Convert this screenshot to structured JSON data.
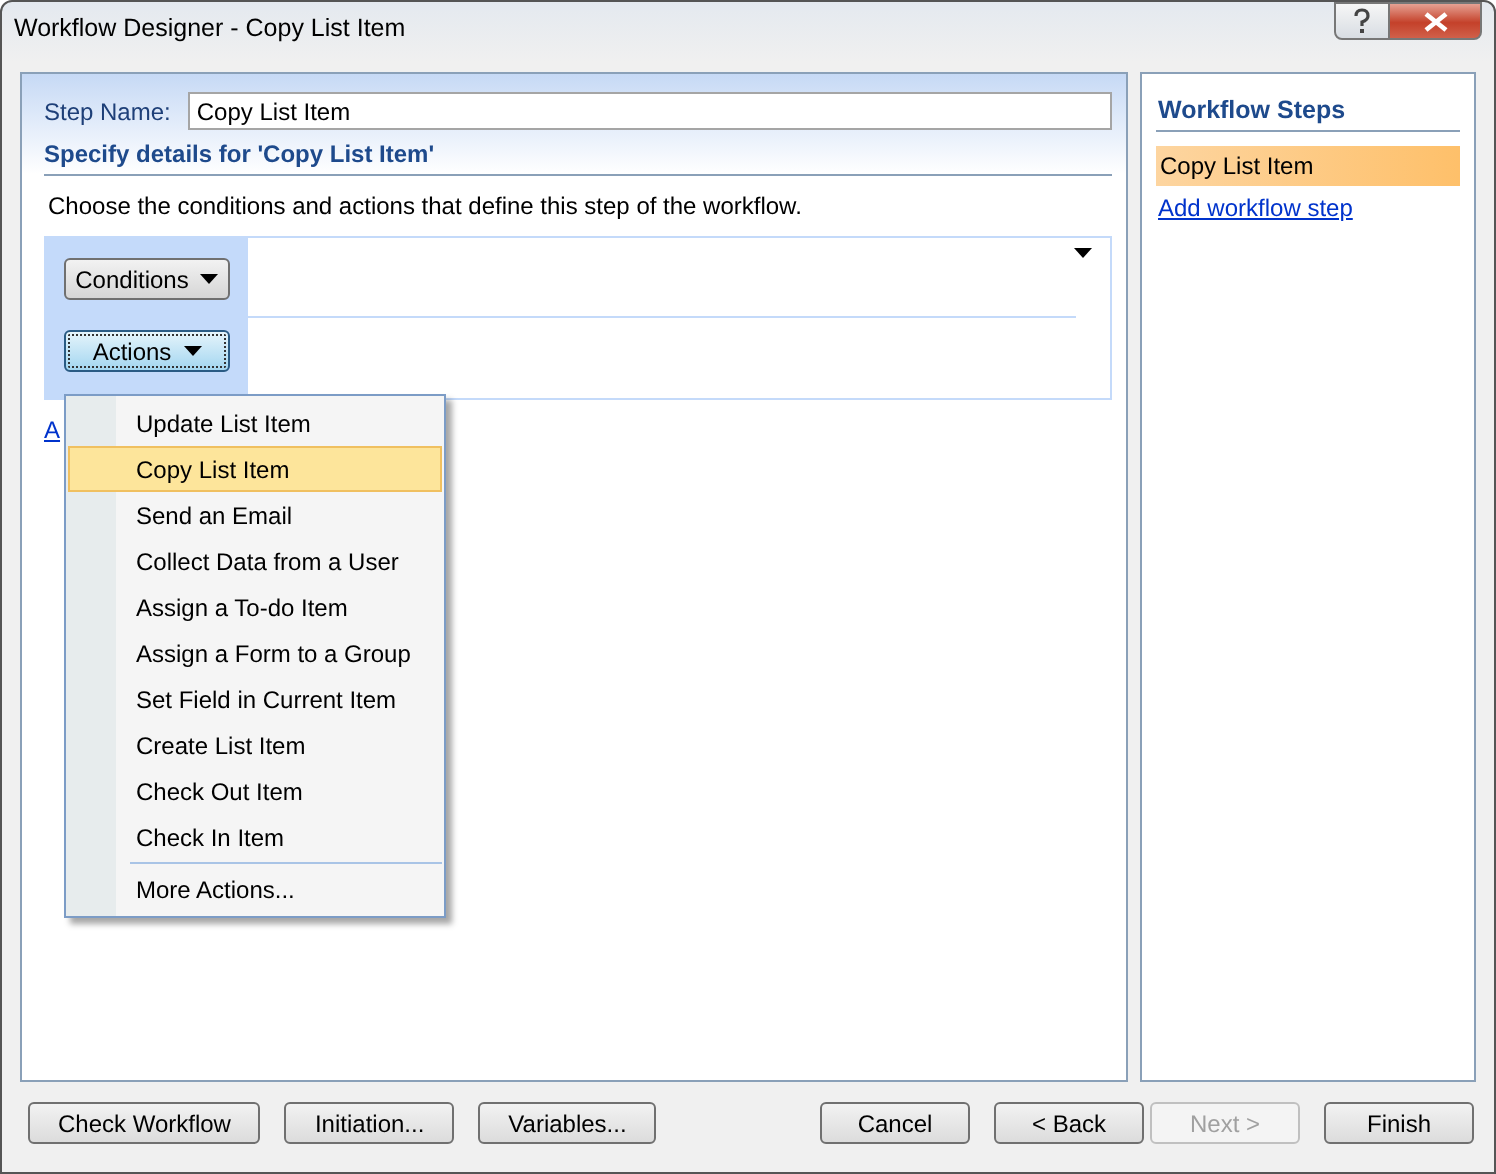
{
  "window": {
    "title": "Workflow Designer - Copy List Item"
  },
  "step_name": {
    "label": "Step Name:",
    "value": "Copy List Item"
  },
  "details": {
    "heading": "Specify details for 'Copy List Item'",
    "instruction": "Choose the conditions and actions that define this step of the workflow.",
    "conditions_button": "Conditions",
    "actions_button": "Actions",
    "branch_link": "A"
  },
  "actions_menu": {
    "items": [
      {
        "label": "Update List Item",
        "selected": false
      },
      {
        "label": "Copy List Item",
        "selected": true
      },
      {
        "label": "Send an Email",
        "selected": false
      },
      {
        "label": "Collect Data from a User",
        "selected": false
      },
      {
        "label": "Assign a To-do Item",
        "selected": false
      },
      {
        "label": "Assign a Form to a Group",
        "selected": false
      },
      {
        "label": "Set Field in Current Item",
        "selected": false
      },
      {
        "label": "Create List Item",
        "selected": false
      },
      {
        "label": "Check Out Item",
        "selected": false
      },
      {
        "label": "Check In Item",
        "selected": false
      }
    ],
    "more": "More Actions..."
  },
  "workflow_steps": {
    "title": "Workflow Steps",
    "steps": [
      {
        "label": "Copy List Item",
        "selected": true
      }
    ],
    "add_link": "Add workflow step"
  },
  "left_buttons": [
    {
      "label": "Check Workflow",
      "disabled": false
    },
    {
      "label": "Initiation...",
      "disabled": false
    },
    {
      "label": "Variables...",
      "disabled": false
    }
  ],
  "right_buttons": [
    {
      "label": "Cancel",
      "disabled": false
    },
    {
      "label": "< Back",
      "disabled": false
    },
    {
      "label": "Next >",
      "disabled": true
    },
    {
      "label": "Finish",
      "disabled": false
    }
  ]
}
